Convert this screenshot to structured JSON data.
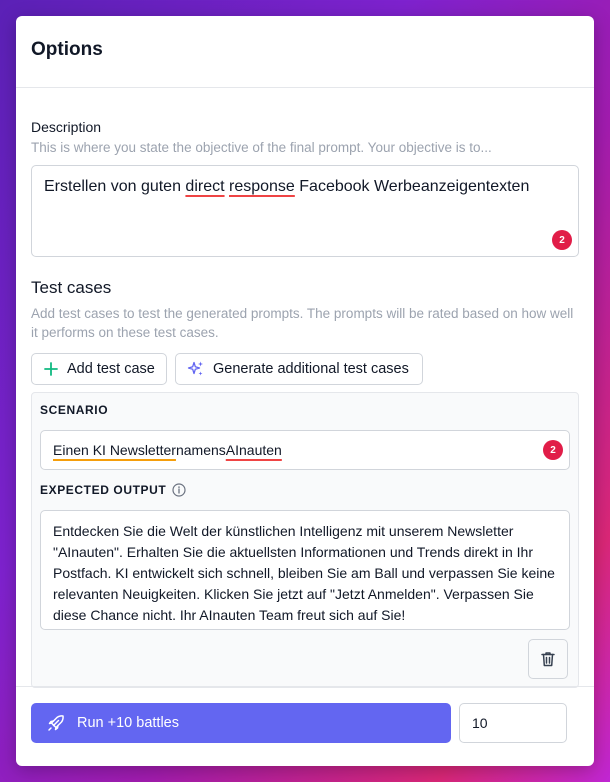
{
  "header": {
    "title": "Options"
  },
  "description": {
    "label": "Description",
    "hint": "This is where you state the objective of the final prompt. Your objective is to...",
    "value_parts": [
      "Erstellen von guten ",
      "direct",
      " ",
      "response",
      " Facebook Werbeanzeigentexten"
    ],
    "issues_count": "2"
  },
  "test_cases": {
    "title": "Test cases",
    "hint": "Add test cases to test the generated prompts. The prompts will be rated based on how well it performs on these test cases.",
    "add_label": "Add test case",
    "generate_label": "Generate additional test cases",
    "items": [
      {
        "scenario_label": "SCENARIO",
        "scenario_parts": [
          "Einen KI Newsletter",
          " namens ",
          "AInauten"
        ],
        "scenario_issues": "2",
        "expected_label": "EXPECTED OUTPUT",
        "expected_text": "Entdecken Sie die Welt der künstlichen Intelligenz mit unserem Newsletter \"AInauten\". Erhalten Sie die aktuellsten Informationen und Trends direkt in Ihr Postfach. KI entwickelt sich schnell, bleiben Sie am Ball und verpassen Sie keine relevanten Neuigkeiten. Klicken Sie jetzt auf \"Jetzt Anmelden\". Verpassen Sie diese Chance nicht. Ihr AInauten Team freut sich auf Sie!"
      }
    ]
  },
  "footer": {
    "run_label": "Run +10 battles",
    "count_value": "10"
  },
  "icons": {
    "plus": "plus-icon",
    "sparkles": "sparkles-icon",
    "info": "info-icon",
    "trash": "trash-icon",
    "rocket": "rocket-icon"
  },
  "colors": {
    "accent": "#6366f1",
    "badge": "#e11d48",
    "plus": "#10b981",
    "sparkle": "#6366f1"
  }
}
